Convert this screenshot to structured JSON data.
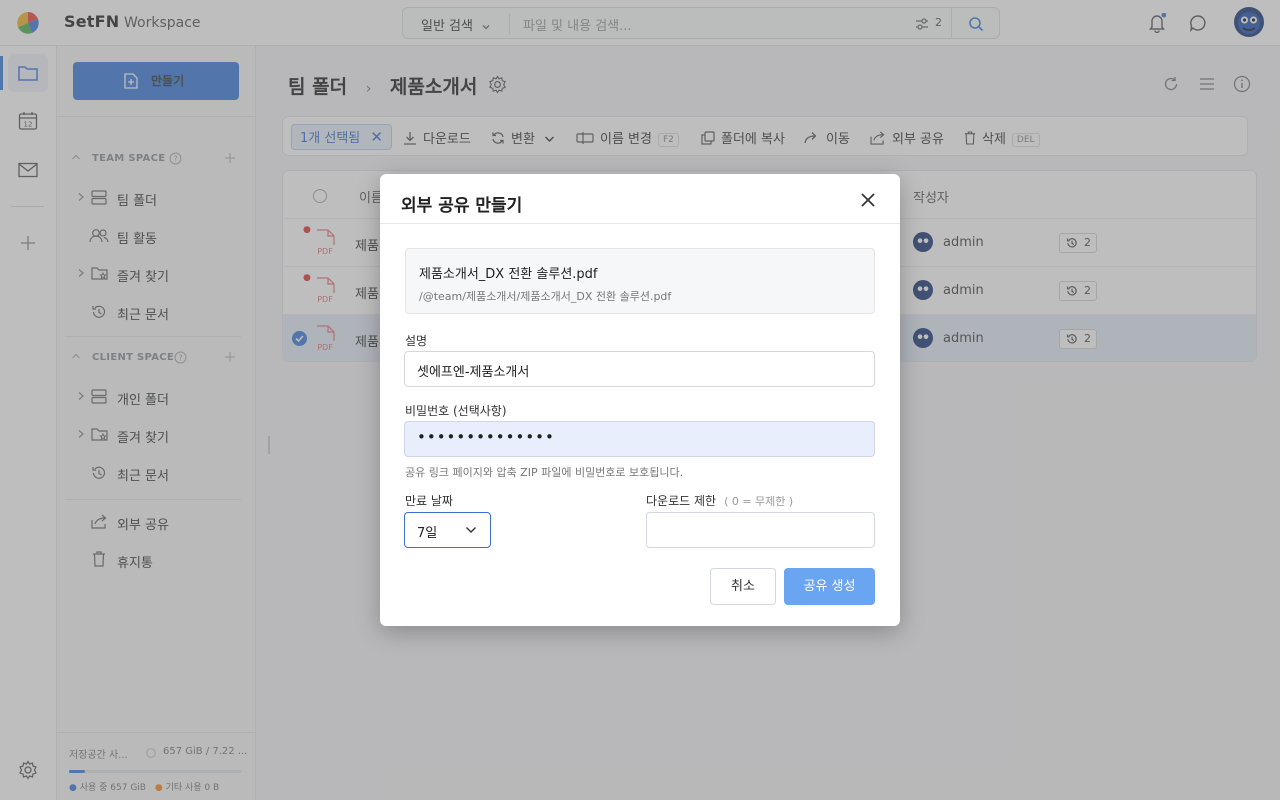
{
  "app": {
    "brand": "SetFN",
    "workspace": "Workspace"
  },
  "search": {
    "mode": "일반 검색",
    "placeholder": "파일 및 내용 검색...",
    "filter_count": "2"
  },
  "sidebar": {
    "create_label": "만들기",
    "team_space": "TEAM SPACE",
    "team_items": [
      "팀 폴더",
      "팀 활동",
      "즐겨 찾기",
      "최근 문서"
    ],
    "client_space": "CLIENT SPACE",
    "client_items": [
      "개인 폴더",
      "즐겨 찾기",
      "최근 문서"
    ],
    "extra_items": [
      "외부 공유",
      "휴지통"
    ],
    "storage_label": "저장공간 사...",
    "storage_value": "657 GiB / 7.22 ...",
    "storage_used_fraction": 0.09,
    "used_legend": "사용 중 657 GiB",
    "other_legend": "기타 사용 0 B"
  },
  "breadcrumb": {
    "root": "팀 폴더",
    "current": "제품소개서"
  },
  "toolbar": {
    "selected": "1개 선택됨",
    "download": "다운로드",
    "convert": "변환",
    "rename": "이름 변경",
    "rename_key": "F2",
    "copy": "폴더에 복사",
    "move": "이동",
    "share": "외부 공유",
    "delete": "삭제",
    "delete_key": "DEL"
  },
  "table": {
    "col_name": "이름",
    "col_author": "작성자",
    "rows": [
      {
        "name": "제품",
        "author": "admin",
        "versions": "2",
        "selected": false
      },
      {
        "name": "제품",
        "author": "admin",
        "versions": "2",
        "selected": false
      },
      {
        "name": "제품",
        "author": "admin",
        "versions": "2",
        "selected": true
      }
    ],
    "file_type": "PDF"
  },
  "dialog": {
    "title": "외부 공유 만들기",
    "file_name": "제품소개서_DX 전환 솔루션.pdf",
    "file_path": "/@team/제품소개서/제품소개서_DX 전환 솔루션.pdf",
    "desc_label": "설명",
    "desc_value": "셋에프엔-제품소개서",
    "pw_label": "비밀번호 (선택사항)",
    "pw_value": "••••••••••••••",
    "pw_help": "공유 링크 페이지와 압축 ZIP 파일에 비밀번호로 보호됩니다.",
    "expire_label": "만료 날짜",
    "expire_value": "7일",
    "limit_label": "다운로드 제한",
    "limit_hint": "( 0 = 무제한 )",
    "limit_value": "",
    "cancel": "취소",
    "submit": "공유 생성"
  }
}
